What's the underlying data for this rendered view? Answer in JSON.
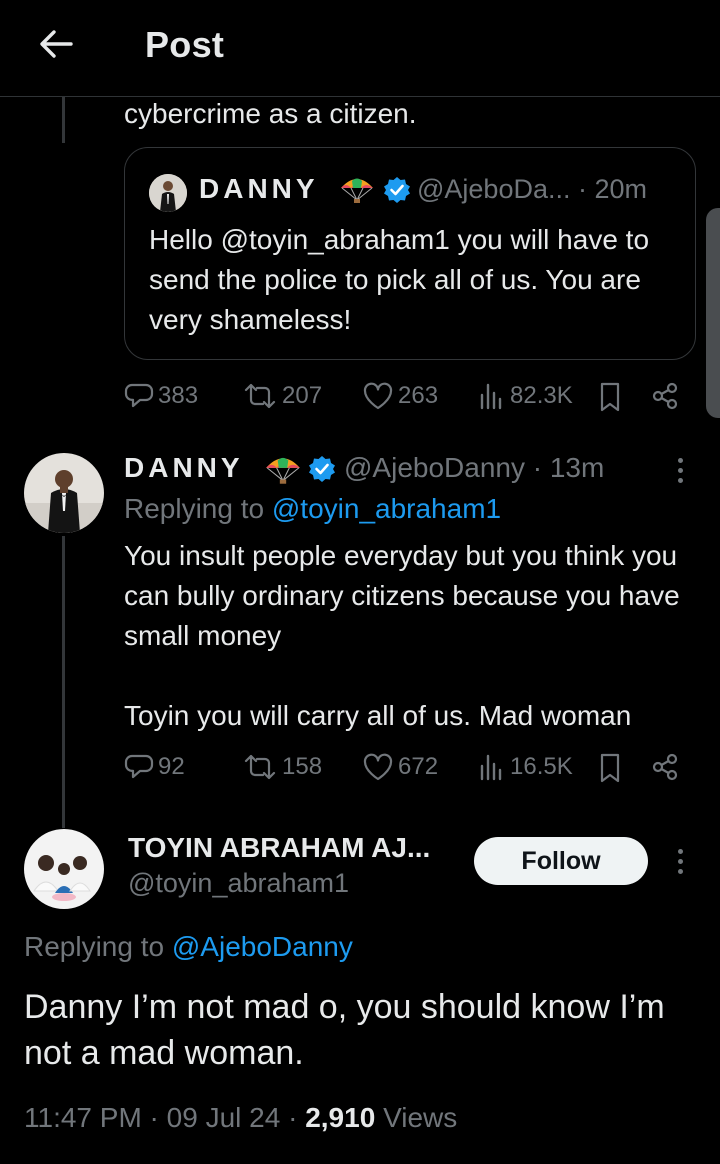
{
  "header": {
    "title": "Post",
    "back_icon": "arrow-left-icon"
  },
  "continuation_text": "cybercrime as a citizen.",
  "quote": {
    "name": "DANNY",
    "meta": "@AjeboDa... · 20m",
    "text": "Hello @toyin_abraham1 you will have to send the police to pick all of us. You are very shameless!"
  },
  "actions_1": {
    "replies": "383",
    "reposts": "207",
    "likes": "263",
    "views": "82.3K"
  },
  "reply": {
    "name": "DANNY",
    "meta": "@AjeboDanny · 13m",
    "replying_prefix": "Replying to ",
    "replying_to": "@toyin_abraham1",
    "text_line1": "You insult people everyday but you think you can bully ordinary citizens because you have small money",
    "text_line2": "Toyin you will carry all of us. Mad woman"
  },
  "actions_2": {
    "replies": "92",
    "reposts": "158",
    "likes": "672",
    "views": "16.5K"
  },
  "main": {
    "name": "TOYIN ABRAHAM AJ...",
    "handle": "@toyin_abraham1",
    "follow_label": "Follow",
    "replying_prefix": "Replying to ",
    "replying_to": "@AjeboDanny",
    "text": "Danny I’m not mad o, you should know I’m not a mad woman.",
    "time": "11:47 PM",
    "date": "09 Jul 24",
    "views_count": "2,910",
    "views_label": "Views"
  },
  "colors": {
    "background": "#000000",
    "accent": "#1d9bf0",
    "muted": "#71767b",
    "text": "#e7e9ea"
  }
}
